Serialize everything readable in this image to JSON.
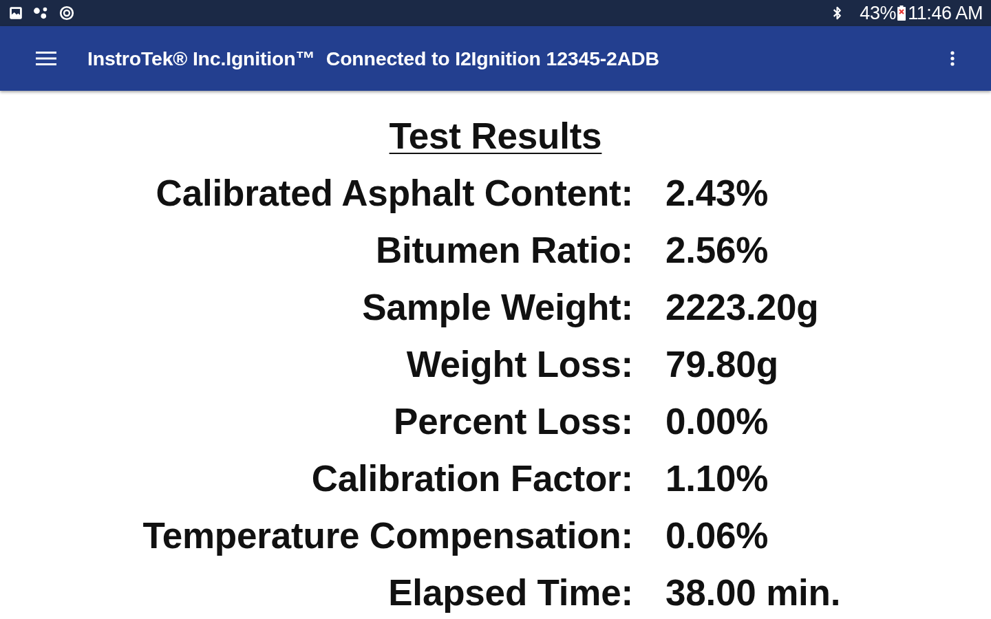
{
  "status_bar": {
    "battery_text": "43%",
    "time": "11:46 AM"
  },
  "app_bar": {
    "title": "InstroTek® Inc.Ignition™",
    "subtitle": "Connected to I2Ignition 12345-2ADB"
  },
  "test_results": {
    "title": "Test Results",
    "rows": [
      {
        "label": "Calibrated Asphalt Content:",
        "value": "2.43%"
      },
      {
        "label": "Bitumen Ratio:",
        "value": "2.56%"
      },
      {
        "label": "Sample Weight:",
        "value": "2223.20g"
      },
      {
        "label": "Weight Loss:",
        "value": "79.80g"
      },
      {
        "label": "Percent Loss:",
        "value": "0.00%"
      },
      {
        "label": "Calibration Factor:",
        "value": "1.10%"
      },
      {
        "label": "Temperature Compensation:",
        "value": "0.06%"
      },
      {
        "label": "Elapsed Time:",
        "value": "38.00 min."
      }
    ]
  }
}
